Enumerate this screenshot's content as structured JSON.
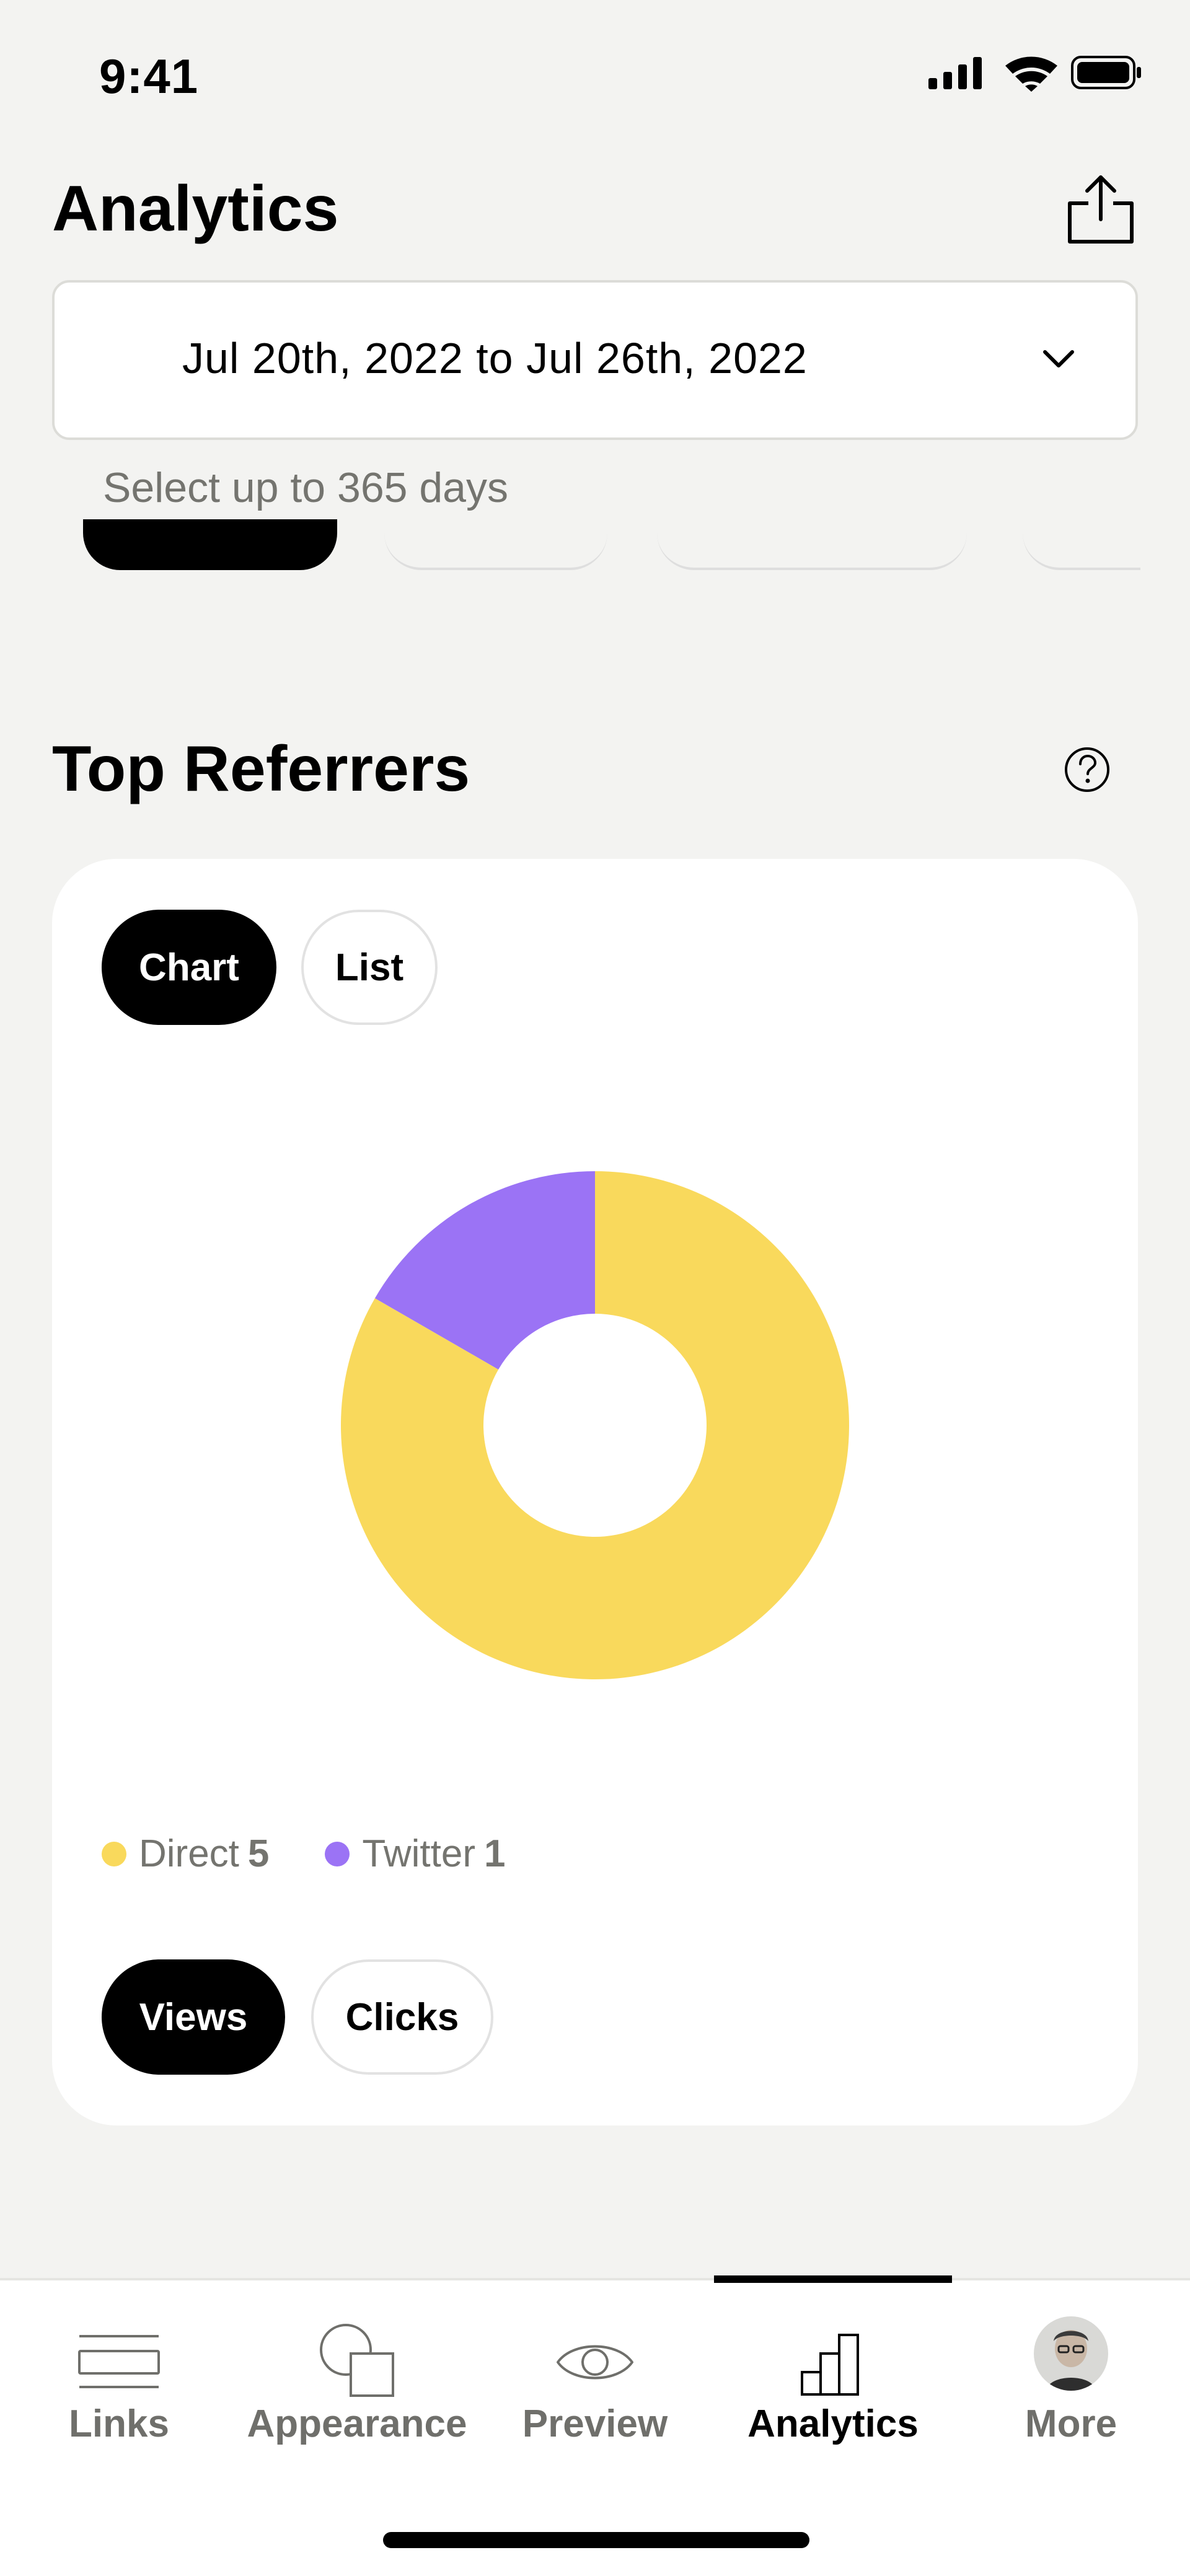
{
  "status_bar": {
    "time": "9:41"
  },
  "header": {
    "title": "Analytics",
    "share_icon": "share-icon"
  },
  "date_range": {
    "value": "Jul 20th, 2022 to Jul 26th, 2022",
    "hint": "Select up to 365 days",
    "icon": "chevron-down-icon"
  },
  "top_referrers": {
    "title": "Top Referrers",
    "help_icon": "question-circle-icon",
    "view_tabs": [
      {
        "label": "Chart",
        "active": true
      },
      {
        "label": "List",
        "active": false
      }
    ],
    "metric_tabs": [
      {
        "label": "Views",
        "active": true
      },
      {
        "label": "Clicks",
        "active": false
      }
    ],
    "legend": [
      {
        "name": "Direct",
        "value": "5",
        "color": "#f9d95c"
      },
      {
        "name": "Twitter",
        "value": "1",
        "color": "#9b73f5"
      }
    ]
  },
  "chart_data": {
    "type": "pie",
    "categories": [
      "Direct",
      "Twitter"
    ],
    "values": [
      5,
      1
    ],
    "colors": [
      "#f9d95c",
      "#9b73f5"
    ],
    "title": "",
    "donut": true
  },
  "bottom_nav": {
    "items": [
      {
        "label": "Links",
        "icon": "links-icon",
        "active": false
      },
      {
        "label": "Appearance",
        "icon": "appearance-icon",
        "active": false
      },
      {
        "label": "Preview",
        "icon": "eye-icon",
        "active": false
      },
      {
        "label": "Analytics",
        "icon": "bar-chart-icon",
        "active": true
      },
      {
        "label": "More",
        "icon": "avatar",
        "active": false
      }
    ]
  }
}
